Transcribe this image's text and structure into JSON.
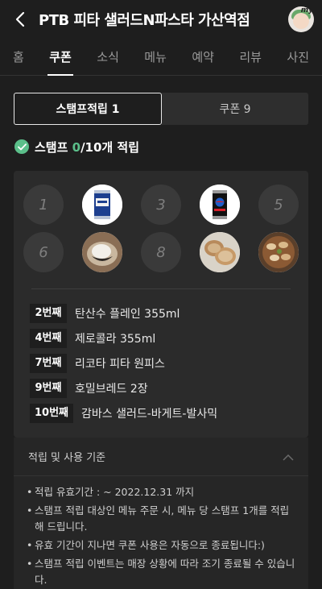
{
  "header": {
    "title": "PTB 피타 샐러드N파스타 가산역점",
    "avatar_label": "my"
  },
  "tabs": [
    {
      "label": "홈",
      "active": false
    },
    {
      "label": "쿠폰",
      "active": true
    },
    {
      "label": "소식",
      "active": false
    },
    {
      "label": "메뉴",
      "active": false
    },
    {
      "label": "예약",
      "active": false
    },
    {
      "label": "리뷰",
      "active": false
    },
    {
      "label": "사진",
      "active": false
    }
  ],
  "segments": {
    "stamp": "스탬프적립 1",
    "coupon": "쿠폰 9"
  },
  "stamp_status": {
    "prefix": "스탬프 ",
    "current": "0",
    "suffix": "/10개 적립"
  },
  "stamps": [
    {
      "num": "1",
      "image": null
    },
    {
      "num": "2",
      "image": "sparkling-water-can"
    },
    {
      "num": "3",
      "image": null
    },
    {
      "num": "4",
      "image": "zero-cola-can"
    },
    {
      "num": "5",
      "image": null
    },
    {
      "num": "6",
      "image": null
    },
    {
      "num": "7",
      "image": "ricotta-pita"
    },
    {
      "num": "8",
      "image": null
    },
    {
      "num": "9",
      "image": "rye-bread"
    },
    {
      "num": "10",
      "image": "gambas-salad"
    }
  ],
  "rewards": [
    {
      "order": "2번째",
      "item": "탄산수 플레인 355ml"
    },
    {
      "order": "4번째",
      "item": "제로콜라 355ml"
    },
    {
      "order": "7번째",
      "item": "리코타 피타 원피스"
    },
    {
      "order": "9번째",
      "item": "호밀브레드 2장"
    },
    {
      "order": "10번째",
      "item": "감바스 샐러드-바게트-발사믹"
    }
  ],
  "rules": {
    "title": "적립 및 사용 기준",
    "items": [
      "적립 유효기간 : ~ 2022.12.31 까지",
      "스탬프 적립 대상인 메뉴 주문 시, 메뉴 당 스탬프 1개를 적립해 드립니다.",
      "유효 기간이 지나면 쿠폰 사용은 자동으로 종료됩니다:)",
      "스탬프 적립 이벤트는 매장 상황에 따라 조기 종료될 수 있습니다."
    ]
  },
  "colors": {
    "accent": "#5bbf8a",
    "background": "#1e1e1e",
    "card": "#2b2b2b"
  }
}
